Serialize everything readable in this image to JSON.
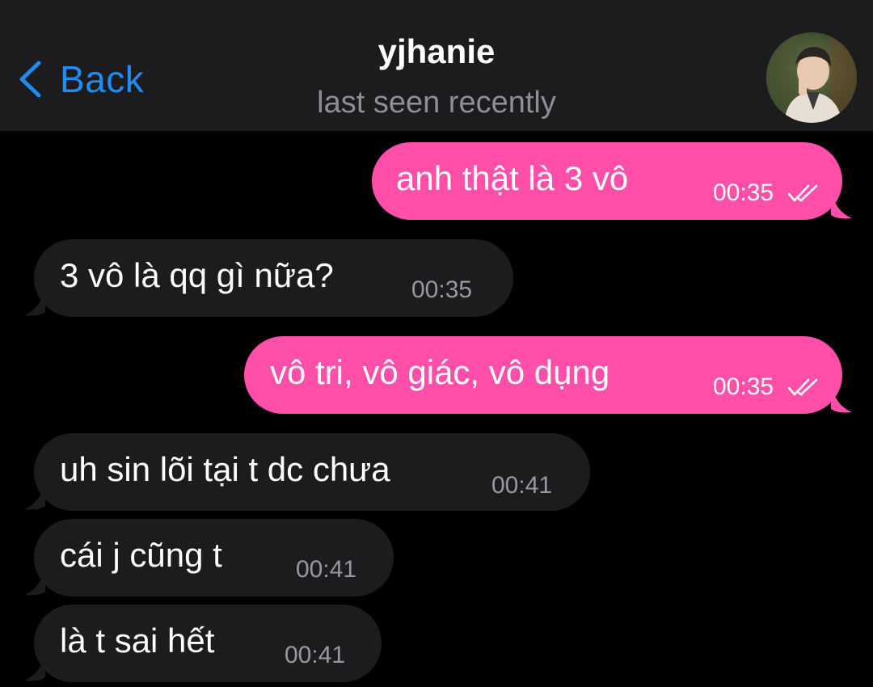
{
  "header": {
    "back_label": "Back",
    "title": "yjhanie",
    "status": "last seen recently"
  },
  "icons": {
    "back": "chevron-left-icon",
    "read_receipt": "double-check-icon",
    "avatar": "contact-avatar"
  },
  "colors": {
    "accent": "#1f8cf3",
    "outgoing_bubble": "#ff4fa8",
    "incoming_bubble": "#1c1c1e",
    "background": "#000000",
    "header_bg": "#1c1c1e"
  },
  "messages": [
    {
      "direction": "outgoing",
      "text": "anh thật là 3 vô",
      "time": "00:35",
      "read": true
    },
    {
      "direction": "incoming",
      "text": "3 vô là qq gì nữa?",
      "time": "00:35"
    },
    {
      "direction": "outgoing",
      "text": "vô tri, vô giác, vô dụng",
      "time": "00:35",
      "read": true
    },
    {
      "direction": "incoming",
      "text": "uh sin lõi tại t dc chưa",
      "time": "00:41"
    },
    {
      "direction": "incoming",
      "text": "cái j cũng t",
      "time": "00:41"
    },
    {
      "direction": "incoming",
      "text": "là t sai hết",
      "time": "00:41"
    }
  ]
}
